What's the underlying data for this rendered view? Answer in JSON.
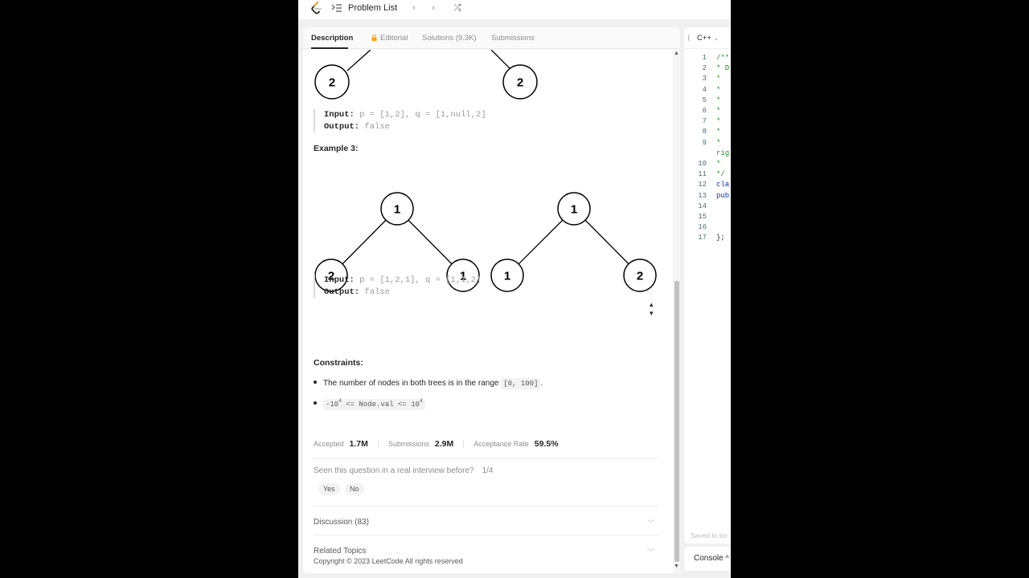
{
  "topbar": {
    "problem_list_label": "Problem List",
    "prev_glyph": "‹",
    "next_glyph": "›",
    "shuffle_glyph": "⤮"
  },
  "tabs": [
    {
      "label": "Description",
      "active": true
    },
    {
      "label": "Editorial",
      "locked": true
    },
    {
      "label": "Solutions (9.3K)"
    },
    {
      "label": "Submissions"
    }
  ],
  "example2": {
    "partial_tree_nodes": [
      "2",
      "2"
    ],
    "input_label": "Input:",
    "input_value": " p = [1,2], q = [1,null,2]",
    "output_label": "Output:",
    "output_value": " false"
  },
  "example3": {
    "title": "Example 3:",
    "tree_p": {
      "root": "1",
      "left": "2",
      "right": "1"
    },
    "tree_q": {
      "root": "1",
      "left": "1",
      "right": "2"
    },
    "input_label": "Input:",
    "input_value": " p = [1,2,1], q = [1,1,2]",
    "output_label": "Output:",
    "output_value": " false"
  },
  "constraints": {
    "title": "Constraints:",
    "items": [
      {
        "text": "The number of nodes in both trees is in the range ",
        "code": "[0, 100]",
        "suffix": "."
      },
      {
        "code_parts": [
          "-10",
          "4",
          " <= Node.val <= 10",
          "4"
        ]
      }
    ]
  },
  "stats": {
    "accepted_label": "Accepted",
    "accepted_value": "1.7M",
    "submissions_label": "Submissions",
    "submissions_value": "2.9M",
    "rate_label": "Acceptance Rate",
    "rate_value": "59.5%"
  },
  "interview": {
    "question": "Seen this question in a real interview before?",
    "count": "1/4",
    "yes": "Yes",
    "no": "No"
  },
  "accordions": [
    {
      "label": "Discussion (83)"
    },
    {
      "label": "Related Topics"
    }
  ],
  "copyright": "Copyright © 2023 LeetCode All rights reserved",
  "editor": {
    "language": "C++",
    "lines": [
      {
        "n": "1",
        "t": "/**",
        "cls": "cm"
      },
      {
        "n": "2",
        "t": " * D",
        "cls": "cm"
      },
      {
        "n": "3",
        "t": " *",
        "cls": "cm"
      },
      {
        "n": "4",
        "t": " *",
        "cls": "cm"
      },
      {
        "n": "5",
        "t": " *",
        "cls": "cm"
      },
      {
        "n": "6",
        "t": " *",
        "cls": "cm"
      },
      {
        "n": "7",
        "t": " *",
        "cls": "cm"
      },
      {
        "n": "8",
        "t": " *",
        "cls": "cm"
      },
      {
        "n": "9",
        "t": " *",
        "cls": "cm"
      },
      {
        "n": "",
        "t": "rig",
        "cls": "cm"
      },
      {
        "n": "10",
        "t": " *",
        "cls": "cm"
      },
      {
        "n": "11",
        "t": " */",
        "cls": "cm"
      },
      {
        "n": "12",
        "t": "cla",
        "cls": "kw"
      },
      {
        "n": "13",
        "t": "pub",
        "cls": "kw"
      },
      {
        "n": "14",
        "t": "",
        "cls": "pl"
      },
      {
        "n": "15",
        "t": "",
        "cls": "pl"
      },
      {
        "n": "16",
        "t": "",
        "cls": "pl"
      },
      {
        "n": "17",
        "t": "};",
        "cls": "pl"
      }
    ],
    "saved_text": "Saved to loc"
  },
  "console": {
    "label": "Console",
    "chevron": "^"
  },
  "colors": {
    "background": "#000000",
    "panel": "#ffffff",
    "app_bg": "#f0f0f0",
    "text_primary": "#262626",
    "text_muted": "#8c8c8c",
    "lock_orange": "#ffa116",
    "logo_orange": "#ffa116",
    "code_comment": "#228b22"
  },
  "icons": [
    "leetcode-logo-icon",
    "problem-list-icon",
    "chevron-left-icon",
    "chevron-right-icon",
    "shuffle-icon",
    "lock-icon",
    "sort-icon",
    "chevron-down-icon",
    "chevron-up-icon"
  ]
}
